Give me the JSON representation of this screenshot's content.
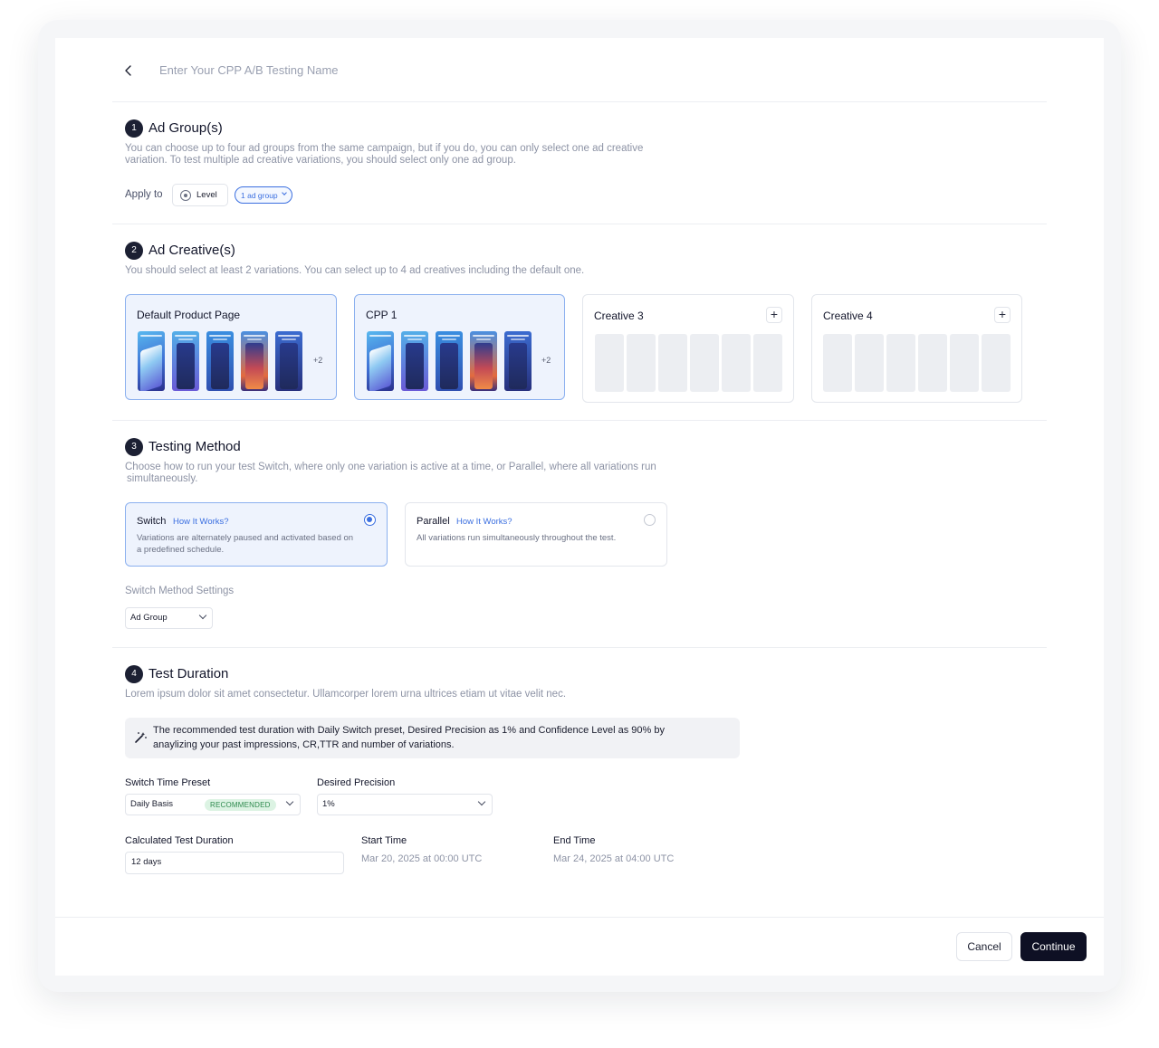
{
  "header": {
    "name_placeholder": "Enter Your CPP A/B Testing Name"
  },
  "section1": {
    "number": "1",
    "title": "Ad Group(s)",
    "description_1": "You can choose up to four ad groups from the same campaign, but if you do, you can only select one ad creative",
    "description_2": "variation. To test multiple ad creative variations, you should select only one ad group.",
    "apply_to_label": "Apply to",
    "level_label": "Level",
    "ad_group_pill": "1 ad group"
  },
  "section2": {
    "number": "2",
    "title": "Ad Creative(s)",
    "description": "You should select at least 2 variations. You can select up to 4 ad creatives including the default one.",
    "creatives": [
      {
        "title": "Default Product Page",
        "extra": "+2"
      },
      {
        "title": "CPP 1",
        "extra": "+2"
      },
      {
        "title": "Creative 3"
      },
      {
        "title": "Creative 4"
      }
    ]
  },
  "section3": {
    "number": "3",
    "title": "Testing Method",
    "description_1": "Choose how to run your test Switch, where only one variation is active at a time, or Parallel, where all variations run",
    "description_2": "simultaneously.",
    "switch": {
      "title": "Switch",
      "link": "How It Works?",
      "desc_1": "Variations are alternately paused and activated based on",
      "desc_2": "a predefined schedule."
    },
    "parallel": {
      "title": "Parallel",
      "link": "How It Works?",
      "desc": "All variations run simultaneously throughout the test."
    },
    "settings_label": "Switch Method Settings",
    "settings_value": "Ad Group"
  },
  "section4": {
    "number": "4",
    "title": "Test Duration",
    "description": "Lorem ipsum dolor sit amet consectetur. Ullamcorper lorem urna ultrices etiam ut vitae velit nec.",
    "recommendation_1": "The recommended test duration with Daily Switch preset, Desired Precision as 1% and Confidence Level as 90% by",
    "recommendation_2": "anaylizing your past impressions, CR,TTR and number of variations.",
    "preset_label": "Switch Time Preset",
    "preset_value": "Daily Basis",
    "preset_badge": "RECOMMENDED",
    "precision_label": "Desired Precision",
    "precision_value": "1%",
    "duration_label": "Calculated Test Duration",
    "duration_value": "12 days",
    "start_label": "Start Time",
    "start_value": "Mar 20, 2025 at 00:00 UTC",
    "end_label": "End Time",
    "end_value": "Mar 24, 2025 at 04:00 UTC"
  },
  "footer": {
    "cancel_label": "Cancel",
    "continue_label": "Continue"
  },
  "colors": {
    "accent": "#3b6fe0",
    "dark": "#0e1024",
    "selected_bg": "#eef3fd",
    "badge_bg": "#dcf3e3",
    "badge_text": "#2e8a4e"
  }
}
